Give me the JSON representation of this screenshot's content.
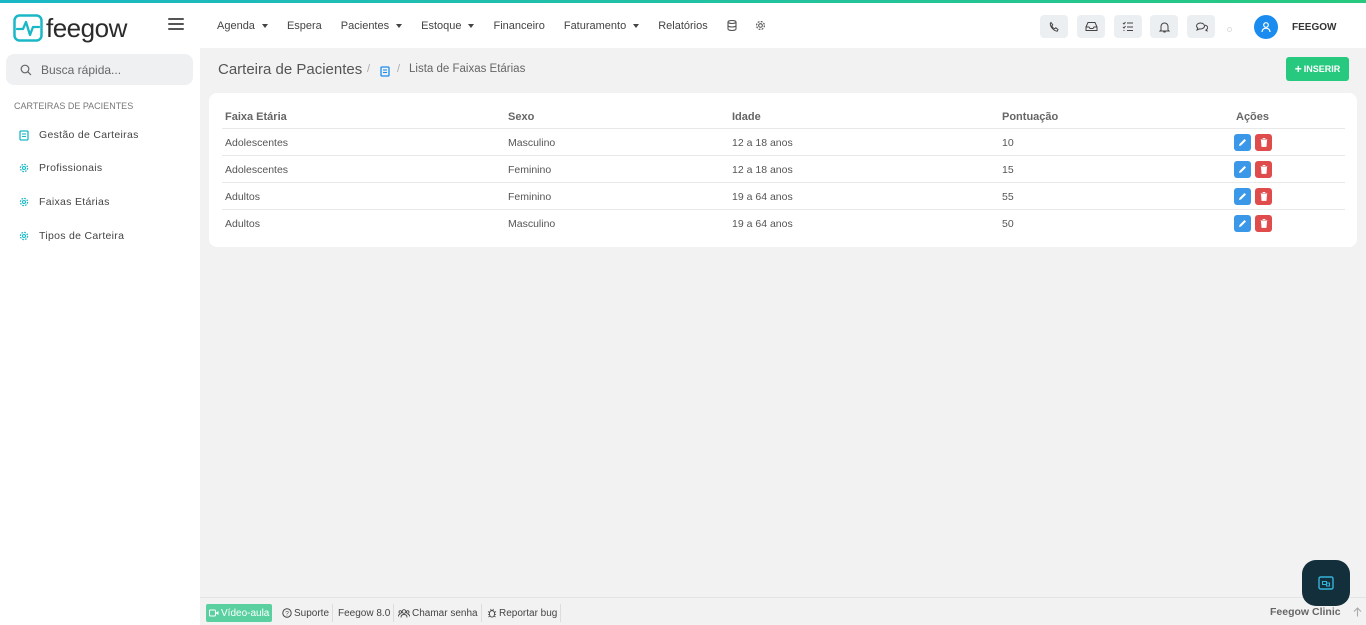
{
  "app": {
    "logo_text": "feegow",
    "brand_color": "#1ab8c6",
    "accent_green": "#27c97f"
  },
  "topnav": {
    "items": [
      {
        "label": "Agenda",
        "dropdown": true
      },
      {
        "label": "Espera",
        "dropdown": false
      },
      {
        "label": "Pacientes",
        "dropdown": true
      },
      {
        "label": "Estoque",
        "dropdown": true
      },
      {
        "label": "Financeiro",
        "dropdown": false
      },
      {
        "label": "Faturamento",
        "dropdown": true
      },
      {
        "label": "Relatórios",
        "dropdown": false
      }
    ],
    "icons": [
      "database-icon",
      "settings-icon"
    ],
    "right_icons": [
      "phone-icon",
      "inbox-icon",
      "tasks-icon",
      "bell-icon",
      "chat-icon"
    ],
    "username": "FEEGOW"
  },
  "sidebar": {
    "search_placeholder": "Busca rápida...",
    "section_title": "CARTEIRAS DE PACIENTES",
    "items": [
      {
        "label": "Gestão de Carteiras",
        "icon": "book-icon"
      },
      {
        "label": "Profissionais",
        "icon": "gear-icon"
      },
      {
        "label": "Faixas Etárias",
        "icon": "gear-icon"
      },
      {
        "label": "Tipos de Carteira",
        "icon": "gear-icon"
      }
    ]
  },
  "page": {
    "title": "Carteira de Pacientes",
    "breadcrumb_current": "Lista de Faixas Etárias",
    "insert_label": "INSERIR"
  },
  "table": {
    "headers": [
      "Faixa Etária",
      "Sexo",
      "Idade",
      "Pontuação",
      "Ações"
    ],
    "rows": [
      [
        "Adolescentes",
        "Masculino",
        "12 a 18 anos",
        "10"
      ],
      [
        "Adolescentes",
        "Feminino",
        "12 a 18 anos",
        "15"
      ],
      [
        "Adultos",
        "Feminino",
        "19 a 64 anos",
        "55"
      ],
      [
        "Adultos",
        "Masculino",
        "19 a 64 anos",
        "50"
      ]
    ]
  },
  "footer": {
    "video": "Vídeo-aula",
    "support": "Suporte",
    "version": "Feegow 8.0",
    "call": "Chamar senha",
    "bug": "Reportar bug",
    "brand": "Feegow Clinic"
  }
}
